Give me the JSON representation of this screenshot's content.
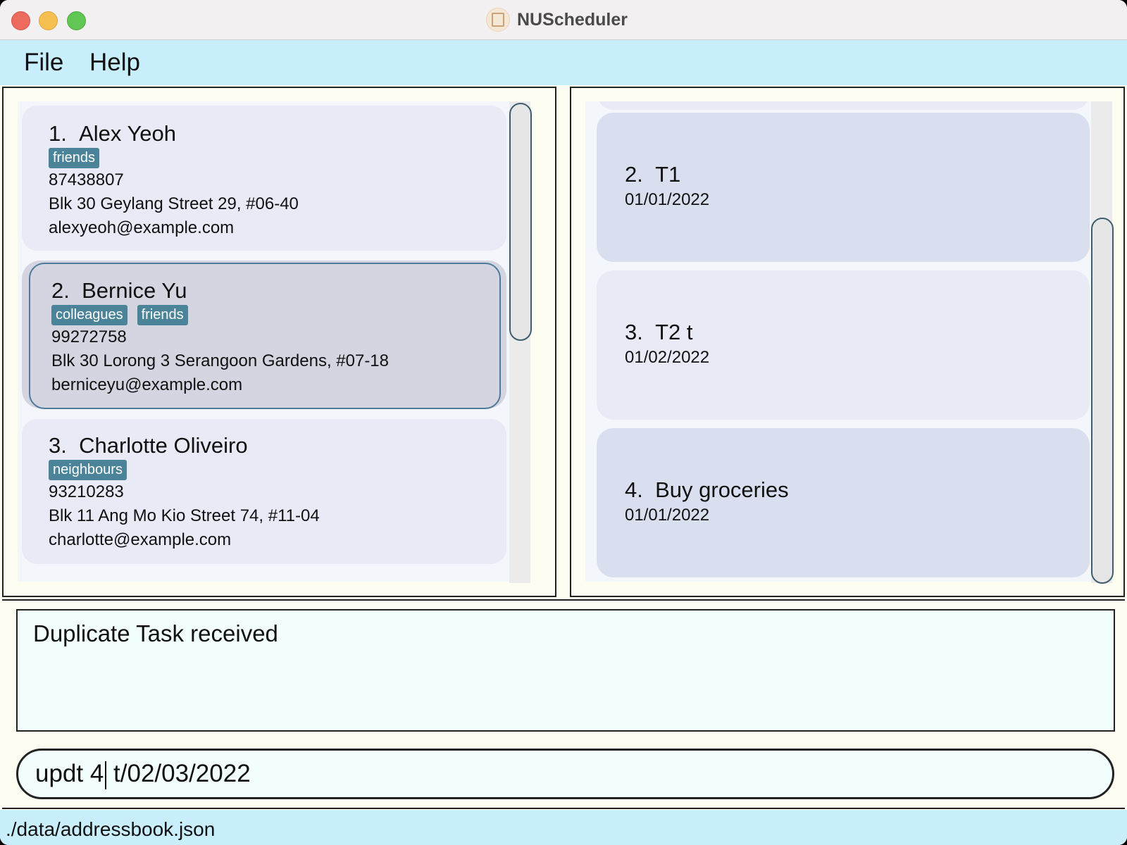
{
  "window": {
    "title": "NUScheduler"
  },
  "menu": {
    "items": [
      "File",
      "Help"
    ]
  },
  "persons": [
    {
      "index": "1.",
      "name": "Alex Yeoh",
      "tags": [
        "friends"
      ],
      "phone": "87438807",
      "address": "Blk 30 Geylang Street 29, #06-40",
      "email": "alexyeoh@example.com"
    },
    {
      "index": "2.",
      "name": "Bernice Yu",
      "tags": [
        "colleagues",
        "friends"
      ],
      "phone": "99272758",
      "address": "Blk 30 Lorong 3 Serangoon Gardens, #07-18",
      "email": "berniceyu@example.com"
    },
    {
      "index": "3.",
      "name": "Charlotte Oliveiro",
      "tags": [
        "neighbours"
      ],
      "phone": "93210283",
      "address": "Blk 11 Ang Mo Kio Street 74, #11-04",
      "email": "charlotte@example.com"
    }
  ],
  "tasks": [
    {
      "index": "2.",
      "title": "T1",
      "date": "01/01/2022"
    },
    {
      "index": "3.",
      "title": "T2 t",
      "date": "01/02/2022"
    },
    {
      "index": "4.",
      "title": "Buy groceries",
      "date": "01/01/2022"
    }
  ],
  "result": {
    "text": "Duplicate Task received"
  },
  "command": {
    "before_caret": "updt 4",
    "after_caret": " t/02/03/2022"
  },
  "status": {
    "path": "./data/addressbook.json"
  },
  "colors": {
    "menubar": "#c9eefc",
    "tag": "#4b8499",
    "card": "#e8eaf6",
    "selected_card": "#d4d5e1",
    "task_card_alt": "#dadff0"
  }
}
